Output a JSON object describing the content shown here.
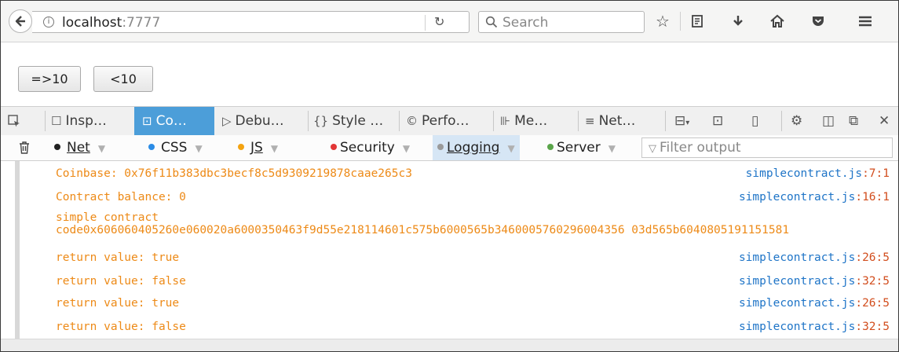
{
  "browser": {
    "url_host": "localhost",
    "url_port": ":7777",
    "search_placeholder": "Search"
  },
  "page": {
    "buttons": [
      "=>10",
      "<10"
    ]
  },
  "devtools": {
    "tabs": [
      {
        "label": "Insp…",
        "icon": "inspector-icon"
      },
      {
        "label": "Co…",
        "icon": "console-icon"
      },
      {
        "label": "Debu…",
        "icon": "debugger-icon"
      },
      {
        "label": "Style …",
        "icon": "style-editor-icon"
      },
      {
        "label": "Perfo…",
        "icon": "performance-icon"
      },
      {
        "label": "Me…",
        "icon": "memory-icon"
      },
      {
        "label": "Net…",
        "icon": "network-icon"
      }
    ],
    "selected_tab": "Co…"
  },
  "filters": {
    "net": "Net",
    "css": "CSS",
    "js": "JS",
    "security": "Security",
    "logging": "Logging",
    "server": "Server",
    "filter_placeholder": "Filter output",
    "colors": {
      "net": "#222222",
      "css": "#2b8ce6",
      "js": "#f4a311",
      "security": "#e23636",
      "logging": "#9a9a9a",
      "server": "#5aa54a"
    }
  },
  "console": {
    "messages": [
      {
        "text": "Coinbase: 0x76f11b383dbc3becf8c5d9309219878caae265c3",
        "file": "simplecontract.js",
        "line": ":7:1"
      },
      {
        "text": "Contract balance: 0",
        "file": "simplecontract.js",
        "line": ":16:1"
      },
      {
        "text": "simple contract",
        "text2": "code0x606060405260e060020a6000350463f9d55e218114601c575b6000565b3460005760296004356 03d565b6040805191151581",
        "file": "",
        "line": ""
      },
      {
        "text": "return value: true",
        "file": "simplecontract.js",
        "line": ":26:5"
      },
      {
        "text": "return value: false",
        "file": "simplecontract.js",
        "line": ":32:5"
      },
      {
        "text": "return value: true",
        "file": "simplecontract.js",
        "line": ":26:5"
      },
      {
        "text": "return value: false",
        "file": "simplecontract.js",
        "line": ":32:5"
      }
    ]
  }
}
